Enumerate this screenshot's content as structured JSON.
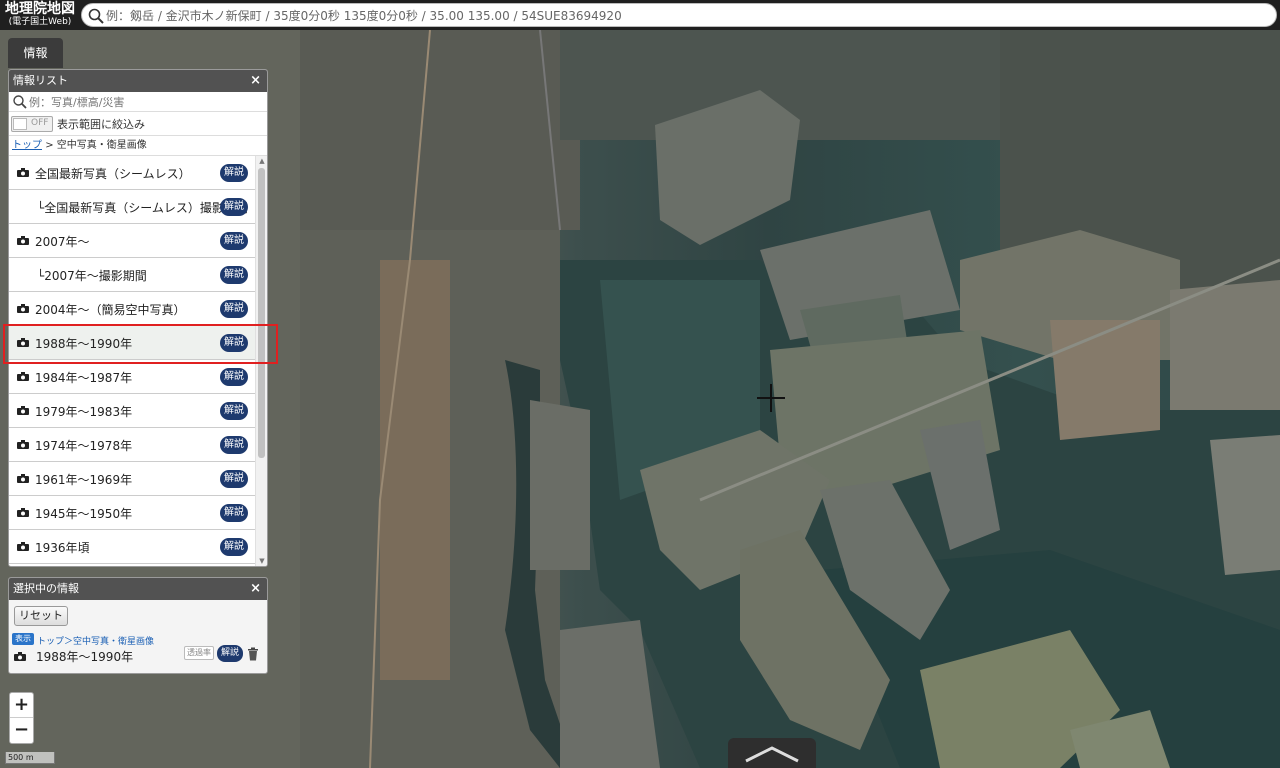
{
  "header": {
    "logo_main": "地理院地図",
    "logo_sub": "(電子国土Web)",
    "search_placeholder": "例：剱岳 / 金沢市木ノ新保町 / 35度0分0秒 135度0分0秒 / 35.00 135.00 / 54SUE83694920"
  },
  "info_tab": {
    "label": "情報"
  },
  "info_list": {
    "title": "情報リスト",
    "close": "×",
    "search_placeholder": "例：写真/標高/災害",
    "filter_toggle_state": "OFF",
    "filter_label": "表示範囲に絞込み",
    "breadcrumb_root": "トップ",
    "breadcrumb_separator": ">",
    "breadcrumb_current": "空中写真・衛星画像",
    "kaisetsu_label": "解説",
    "items": [
      {
        "label": "全国最新写真（シームレス）",
        "sub": false,
        "icon": "camera-icon"
      },
      {
        "label": "└全国最新写真（シームレス）撮影期間",
        "sub": true,
        "icon": ""
      },
      {
        "label": "2007年～",
        "sub": false,
        "icon": "camera-icon"
      },
      {
        "label": "└2007年～撮影期間",
        "sub": true,
        "icon": ""
      },
      {
        "label": "2004年～（簡易空中写真）",
        "sub": false,
        "icon": "camera-icon"
      },
      {
        "label": "1988年～1990年",
        "sub": false,
        "icon": "camera-icon",
        "selected": true
      },
      {
        "label": "1984年～1987年",
        "sub": false,
        "icon": "camera-icon"
      },
      {
        "label": "1979年～1983年",
        "sub": false,
        "icon": "camera-icon"
      },
      {
        "label": "1974年～1978年",
        "sub": false,
        "icon": "camera-icon"
      },
      {
        "label": "1961年～1969年",
        "sub": false,
        "icon": "camera-icon"
      },
      {
        "label": "1945年～1950年",
        "sub": false,
        "icon": "camera-icon"
      },
      {
        "label": "1936年頃",
        "sub": false,
        "icon": "camera-icon"
      }
    ]
  },
  "selected_panel": {
    "title": "選択中の情報",
    "close": "×",
    "reset_label": "リセット",
    "show_badge": "表示",
    "path": "トップ＞空中写真・衛星画像",
    "item_title": "1988年～1990年",
    "transparency_label": "透過率",
    "kaisetsu_label": "解説"
  },
  "zoom": {
    "in": "+",
    "out": "−"
  },
  "scale_label": "500 m",
  "colors": {
    "header_bg": "#1f1f1f",
    "panel_head_bg": "#525252",
    "kaisetsu_bg": "#1e3a6e",
    "highlight_border": "#e02020",
    "link": "#1a5fb4"
  }
}
